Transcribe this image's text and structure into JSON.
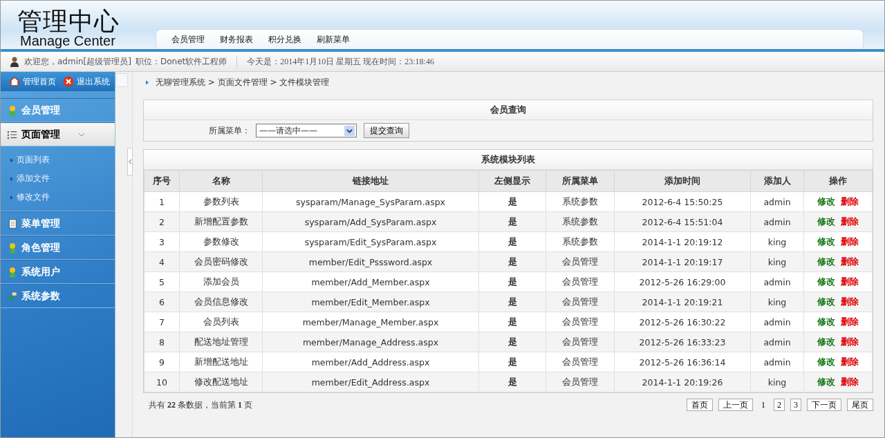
{
  "header": {
    "logo_title": "管理中心",
    "logo_subtitle": "Manage Center",
    "nav": [
      {
        "label": "会员管理"
      },
      {
        "label": "财务报表"
      },
      {
        "label": "积分兑换"
      },
      {
        "label": "刷新菜单"
      }
    ]
  },
  "info_bar": {
    "welcome": "欢迎您，admin[超级管理员]",
    "position": "职位：Donet软件工程师",
    "today": "今天是：2014年1月10日 星期五 现在时间：23:18:46"
  },
  "sidebar": {
    "top_buttons": [
      {
        "label": "管理首页"
      },
      {
        "label": "退出系统"
      }
    ],
    "items": [
      {
        "label": "会员管理",
        "expanded": false
      },
      {
        "label": "页面管理",
        "expanded": true,
        "children": [
          {
            "label": "页面列表"
          },
          {
            "label": "添加文件"
          },
          {
            "label": "修改文件"
          }
        ]
      },
      {
        "label": "菜单管理",
        "expanded": false
      },
      {
        "label": "角色管理",
        "expanded": false
      },
      {
        "label": "系统用户",
        "expanded": false
      },
      {
        "label": "系统参数",
        "expanded": false
      }
    ]
  },
  "breadcrumb": "无聊管理系统 > 页面文件管理 > 文件模块管理",
  "query": {
    "title": "会员查询",
    "label": "所属菜单：",
    "select_value": "——请选中——",
    "button": "提交查询"
  },
  "table": {
    "title": "系统模块列表",
    "columns": [
      "序号",
      "名称",
      "链接地址",
      "左侧显示",
      "所属菜单",
      "添加时间",
      "添加人",
      "操作"
    ],
    "rows": [
      {
        "cells": [
          "1",
          "参数列表",
          "sysparam/Manage_SysParam.aspx",
          "是",
          "系统参数",
          "2012-6-4 15:50:25",
          "admin"
        ],
        "actions": [
          "修改",
          "删除"
        ]
      },
      {
        "cells": [
          "2",
          "新增配置参数",
          "sysparam/Add_SysParam.aspx",
          "是",
          "系统参数",
          "2012-6-4 15:51:04",
          "admin"
        ],
        "actions": [
          "修改",
          "删除"
        ]
      },
      {
        "cells": [
          "3",
          "参数修改",
          "sysparam/Edit_SysParam.aspx",
          "是",
          "系统参数",
          "2014-1-1 20:19:12",
          "king"
        ],
        "actions": [
          "修改",
          "删除"
        ]
      },
      {
        "cells": [
          "4",
          "会员密码修改",
          "member/Edit_Psssword.aspx",
          "是",
          "会员管理",
          "2014-1-1 20:19:17",
          "king"
        ],
        "actions": [
          "修改",
          "删除"
        ]
      },
      {
        "cells": [
          "5",
          "添加会员",
          "member/Add_Member.aspx",
          "是",
          "会员管理",
          "2012-5-26 16:29:00",
          "admin"
        ],
        "actions": [
          "修改",
          "删除"
        ]
      },
      {
        "cells": [
          "6",
          "会员信息修改",
          "member/Edit_Member.aspx",
          "是",
          "会员管理",
          "2014-1-1 20:19:21",
          "king"
        ],
        "actions": [
          "修改",
          "删除"
        ]
      },
      {
        "cells": [
          "7",
          "会员列表",
          "member/Manage_Member.aspx",
          "是",
          "会员管理",
          "2012-5-26 16:30:22",
          "admin"
        ],
        "actions": [
          "修改",
          "删除"
        ]
      },
      {
        "cells": [
          "8",
          "配送地址管理",
          "member/Manage_Address.aspx",
          "是",
          "会员管理",
          "2012-5-26 16:33:23",
          "admin"
        ],
        "actions": [
          "修改",
          "删除"
        ]
      },
      {
        "cells": [
          "9",
          "新增配送地址",
          "member/Add_Address.aspx",
          "是",
          "会员管理",
          "2012-5-26 16:36:14",
          "admin"
        ],
        "actions": [
          "修改",
          "删除"
        ]
      },
      {
        "cells": [
          "10",
          "修改配送地址",
          "member/Edit_Address.aspx",
          "是",
          "会员管理",
          "2014-1-1 20:19:26",
          "king"
        ],
        "actions": [
          "修改",
          "删除"
        ]
      }
    ]
  },
  "footer": {
    "summary": "共有 **22** 条数据，当前第 **1** 页",
    "first": "首页",
    "prev": "上一页",
    "pages": [
      {
        "label": "1",
        "selected": true
      },
      {
        "label": "2",
        "selected": false
      },
      {
        "label": "3",
        "selected": false
      }
    ],
    "next": "下一页",
    "last": "尾页"
  }
}
